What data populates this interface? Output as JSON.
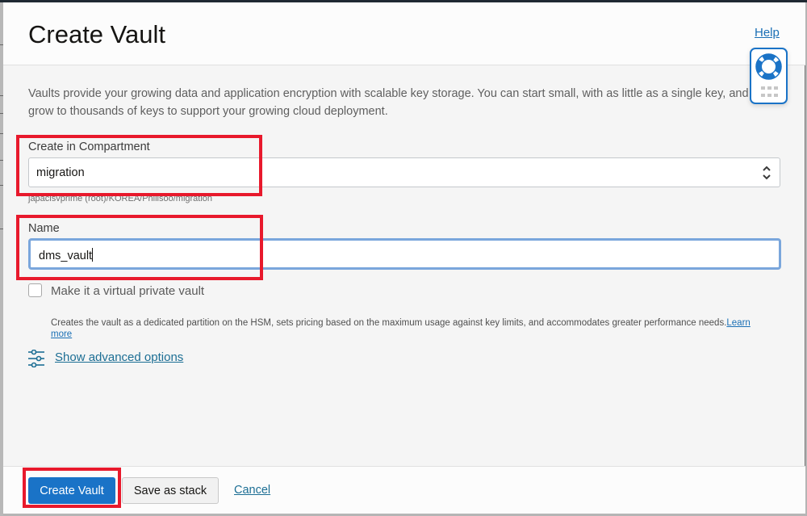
{
  "header": {
    "title": "Create Vault",
    "help_label": "Help"
  },
  "help_widget": {
    "icon": "lifebuoy-icon",
    "grip_icon": "grip-icon",
    "accent_color": "#1a73c7"
  },
  "description": "Vaults provide your growing data and application encryption with scalable key storage. You can start small, with as little as a single key, and grow to thousands of keys to support your growing cloud deployment.",
  "form": {
    "compartment": {
      "label": "Create in Compartment",
      "value": "migration",
      "path": "japacisvprime (root)/KOREA/Phillsoo/migration"
    },
    "name": {
      "label": "Name",
      "value": "dms_vault"
    },
    "virtual_private_vault": {
      "label": "Make it a virtual private vault",
      "checked": false,
      "help_text": "Creates the vault as a dedicated partition on the HSM, sets pricing based on the maximum usage against key limits, and accommodates greater performance needs.",
      "learn_more_label": "Learn more"
    },
    "advanced_options_label": "Show advanced options"
  },
  "footer": {
    "create_label": "Create Vault",
    "save_stack_label": "Save as stack",
    "cancel_label": "Cancel"
  },
  "annotations": {
    "highlight_color": "#e8192c"
  }
}
